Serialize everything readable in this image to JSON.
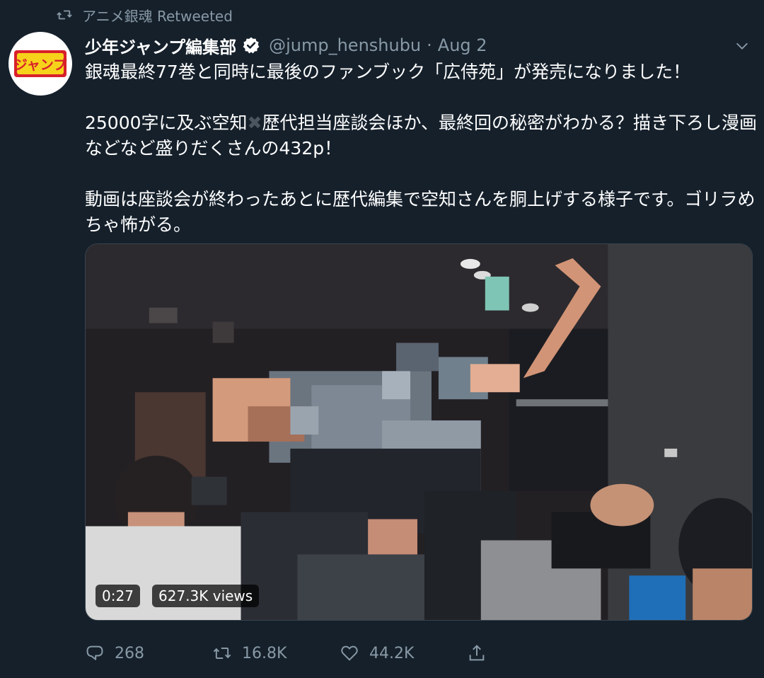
{
  "retweet": {
    "text": "アニメ銀魂 Retweeted",
    "icon": "retweet-icon"
  },
  "author": {
    "display_name": "少年ジャンプ編集部",
    "handle": "@jump_henshubu",
    "separator": "·",
    "date": "Aug 2",
    "avatar_text": "ジャンプ",
    "verified": true
  },
  "tweet": {
    "line1": "銀魂最終77巻と同時に最後のファンブック「広侍苑」が発売になりました！",
    "p2_before": "25000字に及ぶ空知",
    "p2_emoji": "✖",
    "p2_after": "歴代担当座談会ほか、最終回の秘密がわかる？描き下ろし漫画などなど盛りだくさんの432p！",
    "p3": "動画は座談会が終わったあとに歴代編集で空知さんを胴上げする様子です。ゴリラめちゃ怖がる。"
  },
  "media": {
    "duration": "0:27",
    "views": "627.3K views"
  },
  "actions": {
    "reply_count": "268",
    "retweet_count": "16.8K",
    "like_count": "44.2K"
  },
  "colors": {
    "background": "#15202b",
    "secondary_text": "#8899a6",
    "verified": "#ffffff",
    "avatar_red": "#d8202a",
    "avatar_yellow": "#f7d21b"
  }
}
